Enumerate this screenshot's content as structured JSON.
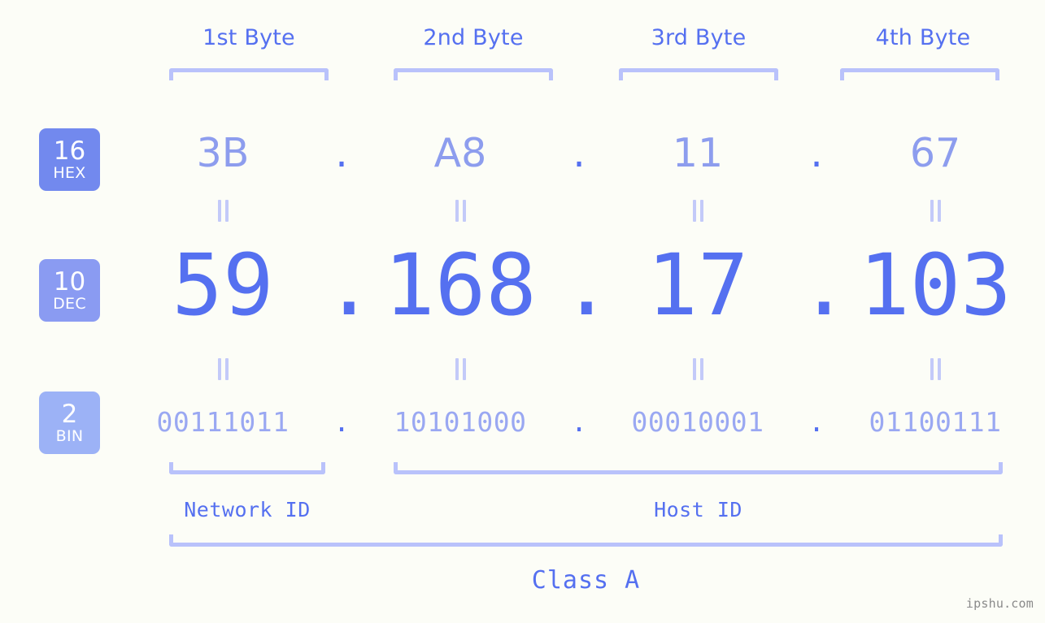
{
  "background_color": "#fcfdf7",
  "accent_color": "#5570f0",
  "muted_accent_color": "#8d9dee",
  "bracket_color": "#b9c2fb",
  "byte_headers": [
    {
      "label": "1st Byte"
    },
    {
      "label": "2nd Byte"
    },
    {
      "label": "3rd Byte"
    },
    {
      "label": "4th Byte"
    }
  ],
  "bases": [
    {
      "number": "16",
      "abbr": "HEX",
      "color": "#7289ee"
    },
    {
      "number": "10",
      "abbr": "DEC",
      "color": "#8a9bf2"
    },
    {
      "number": "2",
      "abbr": "BIN",
      "color": "#9cb2f6"
    }
  ],
  "separator": ".",
  "equals_symbol": "||",
  "rows": {
    "hex": {
      "values": [
        "3B",
        "A8",
        "11",
        "67"
      ]
    },
    "dec": {
      "values": [
        "59",
        "168",
        "17",
        "103"
      ]
    },
    "bin": {
      "values": [
        "00111011",
        "10101000",
        "00010001",
        "01100111"
      ]
    }
  },
  "segments": {
    "network_id": "Network ID",
    "host_id": "Host ID",
    "class": "Class A"
  },
  "watermark": "ipshu.com"
}
